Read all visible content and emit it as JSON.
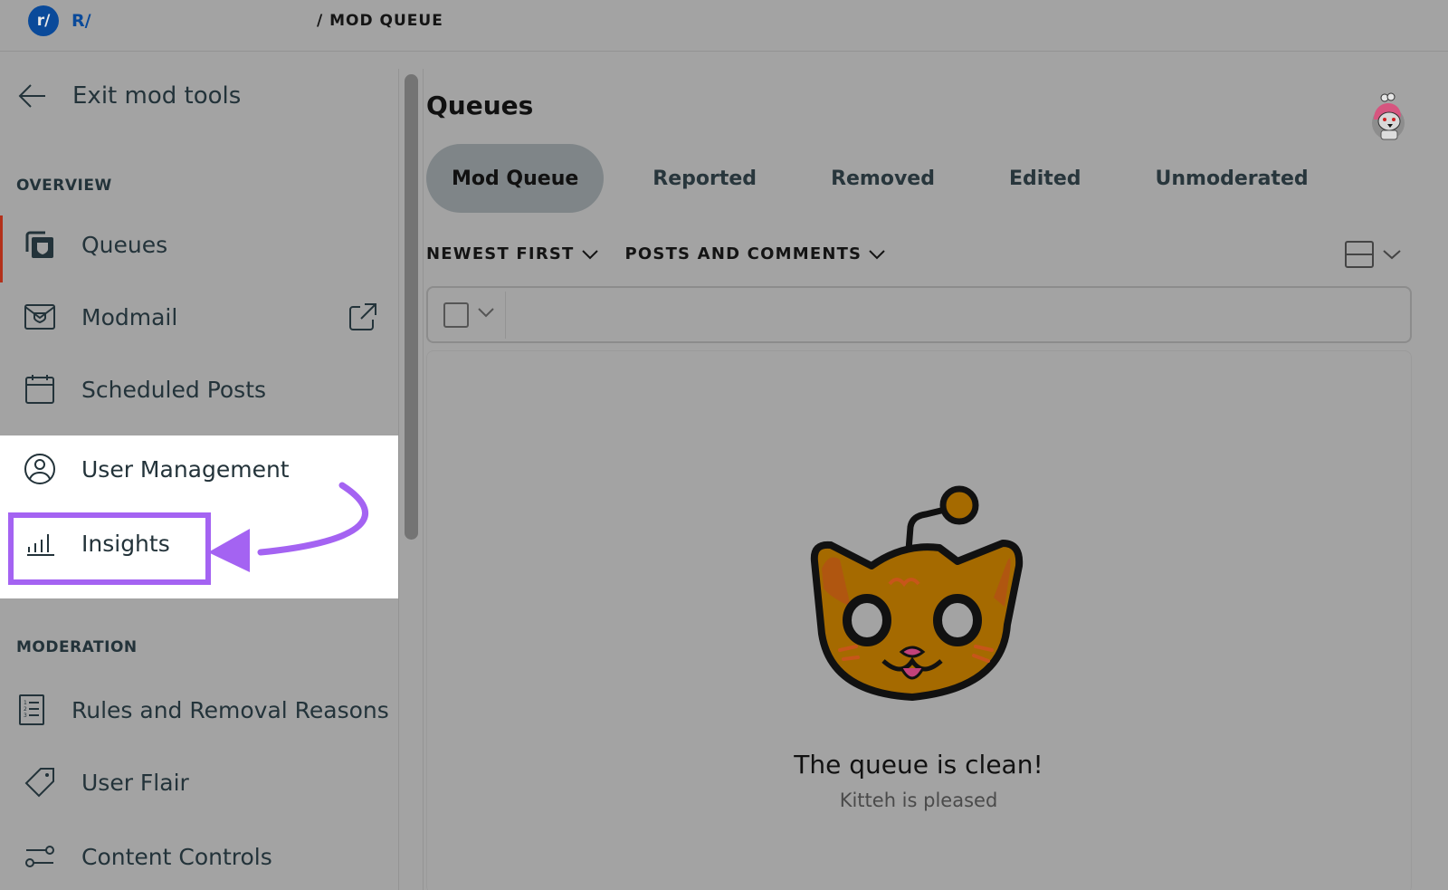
{
  "header": {
    "logo_text": "r/",
    "subreddit_prefix": "R/",
    "breadcrumb": "/ MOD QUEUE"
  },
  "sidebar": {
    "exit_label": "Exit mod tools",
    "sections": [
      {
        "title": "OVERVIEW",
        "items": [
          {
            "label": "Queues",
            "icon": "queues-icon",
            "active": true
          },
          {
            "label": "Modmail",
            "icon": "modmail-icon",
            "external": true
          },
          {
            "label": "Scheduled Posts",
            "icon": "calendar-icon"
          },
          {
            "label": "User Management",
            "icon": "user-circle-icon"
          },
          {
            "label": "Insights",
            "icon": "bar-chart-icon",
            "highlighted": true
          }
        ]
      },
      {
        "title": "MODERATION",
        "items": [
          {
            "label": "Rules and Removal Reasons",
            "icon": "rules-list-icon"
          },
          {
            "label": "User Flair",
            "icon": "tag-icon"
          },
          {
            "label": "Content Controls",
            "icon": "sliders-icon"
          }
        ]
      }
    ]
  },
  "main": {
    "title": "Queues",
    "tabs": [
      {
        "label": "Mod Queue",
        "active": true
      },
      {
        "label": "Reported"
      },
      {
        "label": "Removed"
      },
      {
        "label": "Edited"
      },
      {
        "label": "Unmoderated"
      }
    ],
    "filters": {
      "sort": "NEWEST FIRST",
      "type": "POSTS AND COMMENTS"
    },
    "empty_state": {
      "title": "The queue is clean!",
      "subtitle": "Kitteh is pleased"
    }
  },
  "annotation": {
    "highlight_color": "#a463f2"
  },
  "colors": {
    "brand_blue": "#0a4a9a",
    "active_indicator": "#b3301a",
    "overlay_gray": "#a3a3a3"
  }
}
